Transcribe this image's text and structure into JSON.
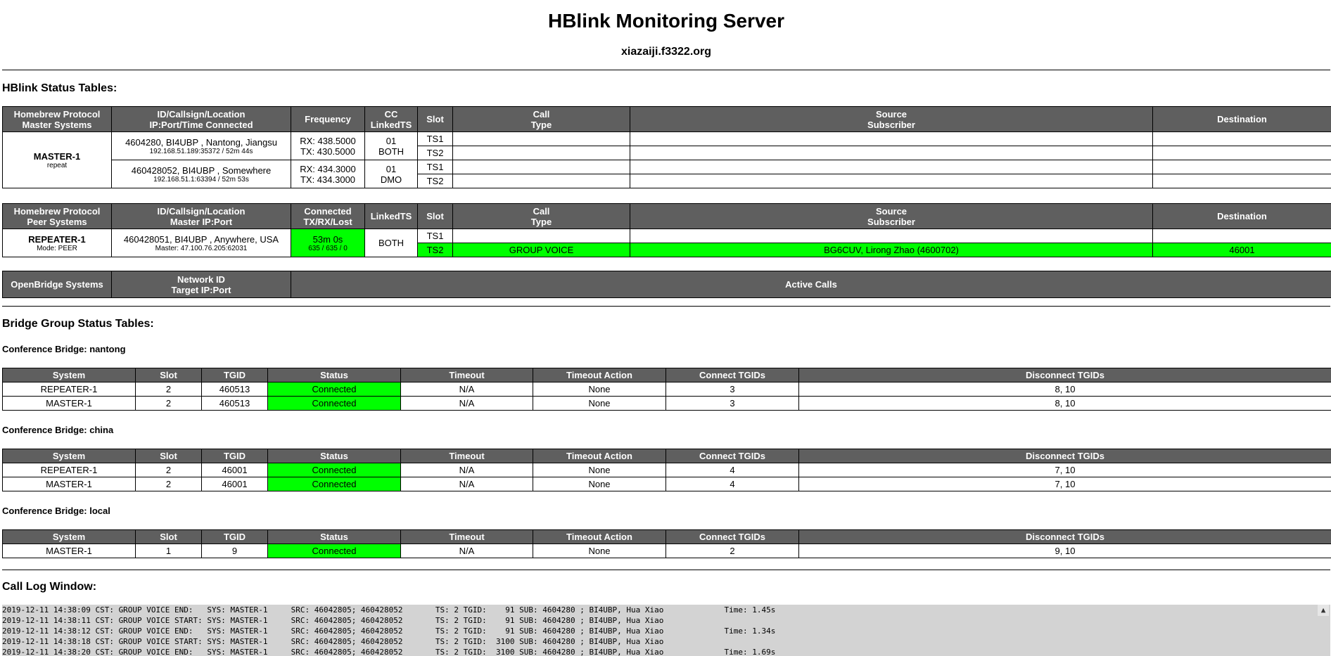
{
  "header": {
    "title": "HBlink Monitoring Server",
    "subtitle": "xiazaiji.f3322.org"
  },
  "status": {
    "section_title": "HBlink Status Tables:",
    "master_table": {
      "headers": {
        "system": [
          "Homebrew Protocol",
          "Master Systems"
        ],
        "id": [
          "ID/Callsign/Location",
          "IP:Port/Time Connected"
        ],
        "frequency": "Frequency",
        "cc": [
          "CC",
          "LinkedTS"
        ],
        "slot": "Slot",
        "call_type": [
          "Call",
          "Type"
        ],
        "source": [
          "Source",
          "Subscriber"
        ],
        "destination": "Destination"
      },
      "system_name": "MASTER-1",
      "system_mode": "repeat",
      "peers": [
        {
          "id_line": "4604280, BI4UBP , Nantong, Jiangsu",
          "ip_line": "192.168.51.189:35372 / 52m 44s",
          "rx": "RX: 438.5000",
          "tx": "TX: 430.5000",
          "cc": "01",
          "linked": "BOTH",
          "slots": [
            "TS1",
            "TS2"
          ]
        },
        {
          "id_line": "460428052, BI4UBP , Somewhere",
          "ip_line": "192.168.51.1:63394 / 52m 53s",
          "rx": "RX: 434.3000",
          "tx": "TX: 434.3000",
          "cc": "01",
          "linked": "DMO",
          "slots": [
            "TS1",
            "TS2"
          ]
        }
      ]
    },
    "peer_table": {
      "headers": {
        "system": [
          "Homebrew Protocol",
          "Peer Systems"
        ],
        "id": [
          "ID/Callsign/Location",
          "Master IP:Port"
        ],
        "connected": [
          "Connected",
          "TX/RX/Lost"
        ],
        "linked": "LinkedTS",
        "slot": "Slot",
        "call_type": [
          "Call",
          "Type"
        ],
        "source": [
          "Source",
          "Subscriber"
        ],
        "destination": "Destination"
      },
      "system_name": "REPEATER-1",
      "system_mode": "Mode: PEER",
      "id_line": "460428051, BI4UBP , Anywhere, USA",
      "master_line": "Master: 47.100.76.205:62031",
      "connected_time": "53m 0s",
      "tx_rx_lost": "635 / 635 / 0",
      "linked": "BOTH",
      "slots": [
        {
          "slot": "TS1",
          "call_type": "",
          "source": "",
          "destination": ""
        },
        {
          "slot": "TS2",
          "call_type": "GROUP VOICE",
          "source": "BG6CUV, Lirong Zhao (4600702)",
          "destination": "46001"
        }
      ]
    },
    "openbridge_table": {
      "headers": {
        "system": "OpenBridge Systems",
        "network": [
          "Network ID",
          "Target IP:Port"
        ],
        "active": "Active Calls"
      }
    }
  },
  "bridges": {
    "section_title": "Bridge Group Status Tables:",
    "columns": [
      "System",
      "Slot",
      "TGID",
      "Status",
      "Timeout",
      "Timeout Action",
      "Connect TGIDs",
      "Disconnect TGIDs"
    ],
    "groups": [
      {
        "title": "Conference Bridge: nantong",
        "rows": [
          [
            "REPEATER-1",
            "2",
            "460513",
            "Connected",
            "N/A",
            "None",
            "3",
            "8, 10"
          ],
          [
            "MASTER-1",
            "2",
            "460513",
            "Connected",
            "N/A",
            "None",
            "3",
            "8, 10"
          ]
        ]
      },
      {
        "title": "Conference Bridge: china",
        "rows": [
          [
            "REPEATER-1",
            "2",
            "46001",
            "Connected",
            "N/A",
            "None",
            "4",
            "7, 10"
          ],
          [
            "MASTER-1",
            "2",
            "46001",
            "Connected",
            "N/A",
            "None",
            "4",
            "7, 10"
          ]
        ]
      },
      {
        "title": "Conference Bridge: local",
        "rows": [
          [
            "MASTER-1",
            "1",
            "9",
            "Connected",
            "N/A",
            "None",
            "2",
            "9, 10"
          ]
        ]
      }
    ]
  },
  "log": {
    "section_title": "Call Log Window:",
    "lines": [
      "2019-12-11 14:38:09 CST: GROUP VOICE END:   SYS: MASTER-1     SRC: 46042805; 460428052       TS: 2 TGID:    91 SUB: 4604280 ; BI4UBP, Hua Xiao             Time: 1.45s",
      "2019-12-11 14:38:11 CST: GROUP VOICE START: SYS: MASTER-1     SRC: 46042805; 460428052       TS: 2 TGID:    91 SUB: 4604280 ; BI4UBP, Hua Xiao",
      "2019-12-11 14:38:12 CST: GROUP VOICE END:   SYS: MASTER-1     SRC: 46042805; 460428052       TS: 2 TGID:    91 SUB: 4604280 ; BI4UBP, Hua Xiao             Time: 1.34s",
      "2019-12-11 14:38:18 CST: GROUP VOICE START: SYS: MASTER-1     SRC: 46042805; 460428052       TS: 2 TGID:  3100 SUB: 4604280 ; BI4UBP, Hua Xiao",
      "2019-12-11 14:38:20 CST: GROUP VOICE END:   SYS: MASTER-1     SRC: 46042805; 460428052       TS: 2 TGID:  3100 SUB: 4604280 ; BI4UBP, Hua Xiao             Time: 1.69s"
    ],
    "scroll_up_glyph": "▲"
  },
  "colors": {
    "header_bg": "#5f5f5f",
    "active_green": "#00ff00",
    "log_bg": "#d3d3d3"
  }
}
